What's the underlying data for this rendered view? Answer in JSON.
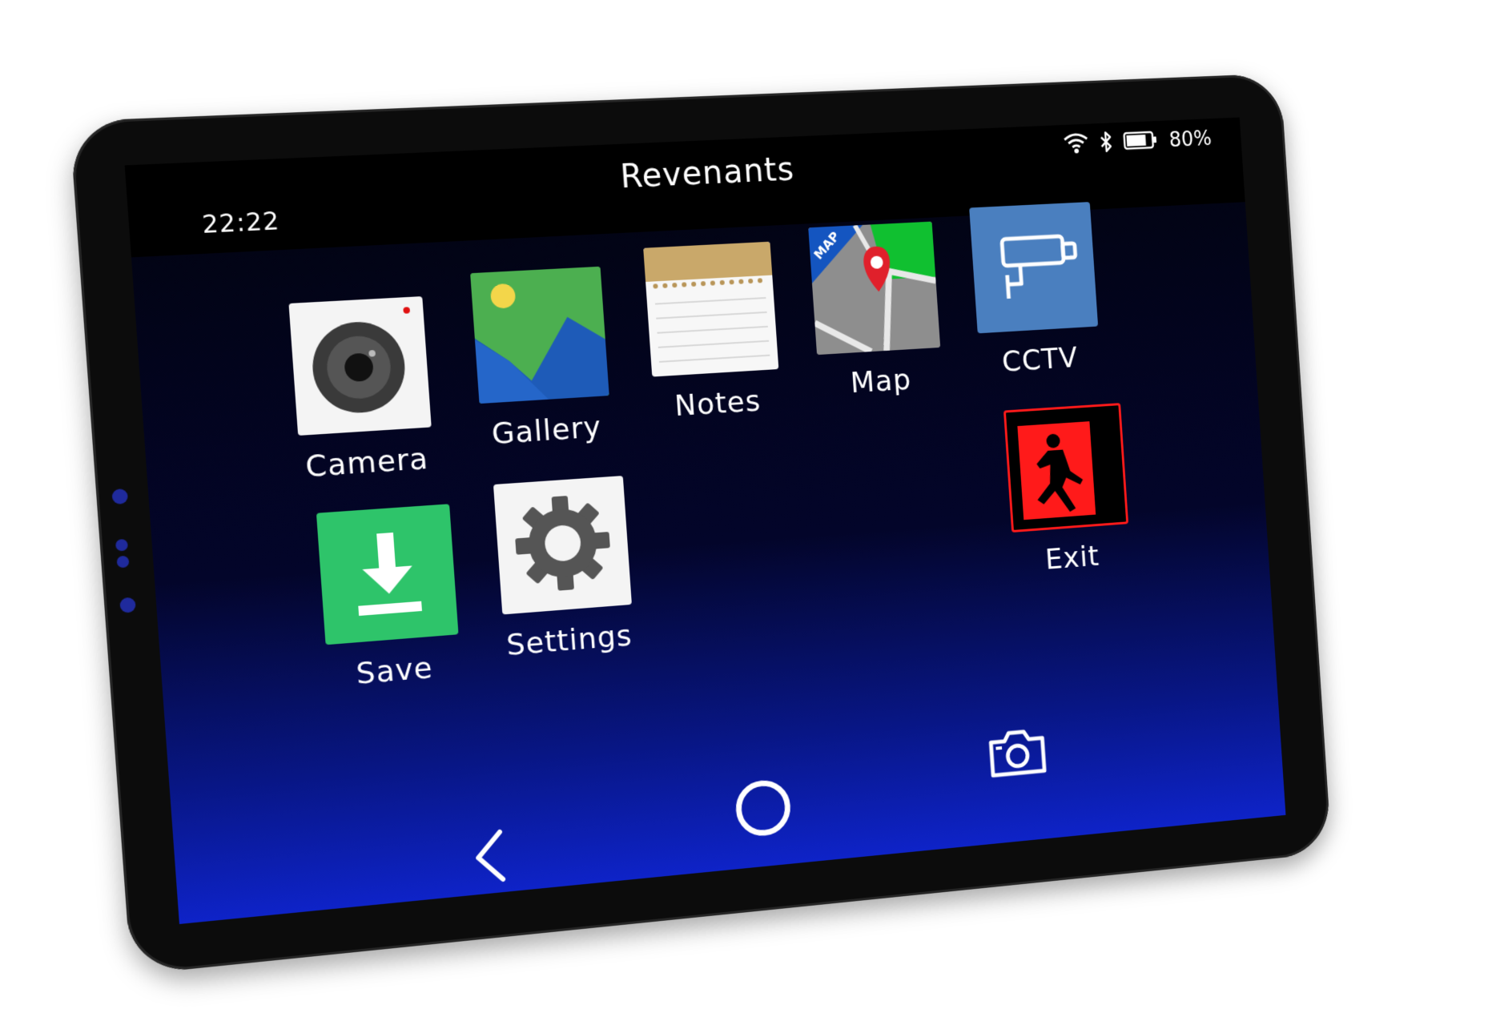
{
  "status_bar": {
    "time": "22:22",
    "title": "Revenants",
    "battery_percent": "80%",
    "battery_level": 0.8,
    "icons": [
      "wifi-icon",
      "bluetooth-icon",
      "battery-icon"
    ]
  },
  "apps": [
    {
      "label": "Camera",
      "icon": "camera-app-icon"
    },
    {
      "label": "Gallery",
      "icon": "gallery-app-icon"
    },
    {
      "label": "Notes",
      "icon": "notes-app-icon"
    },
    {
      "label": "Map",
      "icon": "map-app-icon",
      "badge": "MAP"
    },
    {
      "label": "CCTV",
      "icon": "cctv-app-icon"
    },
    {
      "label": "Save",
      "icon": "save-app-icon"
    },
    {
      "label": "Settings",
      "icon": "settings-app-icon"
    },
    {
      "label": "Exit",
      "icon": "exit-app-icon"
    }
  ],
  "nav_bar": {
    "icons": [
      "back-chevron-icon",
      "home-circle-icon",
      "screenshot-camera-icon"
    ]
  },
  "colors": {
    "screen_top": "#02030f",
    "screen_bottom": "#0e23c8",
    "save_green": "#2ec46a",
    "cctv_blue": "#4a7fbf",
    "exit_red": "#ff1a1a",
    "gallery_green": "#4caf50",
    "gallery_blue": "#1e5bb8",
    "notes_tan": "#c9a86a",
    "map_pin_red": "#e0202b"
  }
}
